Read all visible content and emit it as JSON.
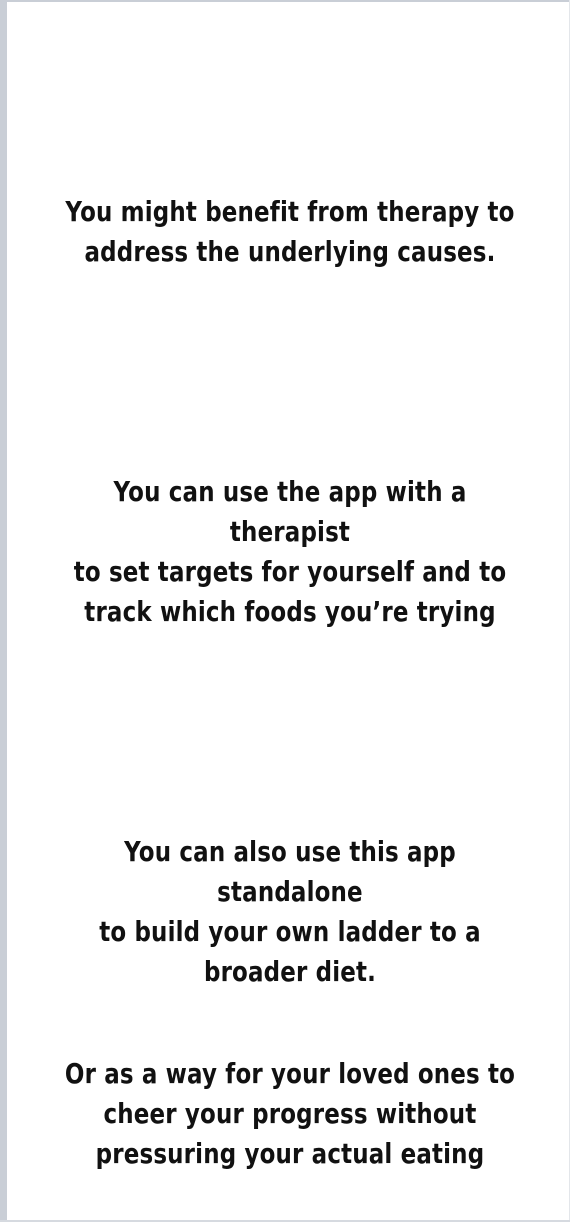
{
  "messages": [
    {
      "text": "You might benefit from therapy to\naddress the underlying causes."
    },
    {
      "text": "You can use the app with a therapist\nto set targets for yourself and to\ntrack which foods you’re trying"
    },
    {
      "text": "You can also use this app standalone\nto build your own ladder to a\nbroader diet."
    },
    {
      "text": "Or as a way for your loved ones to\ncheer your progress without\npressuring your actual eating"
    }
  ],
  "colors": {
    "background": "#ffffff",
    "text": "#111111",
    "frame_edge": "#c9ced6"
  }
}
